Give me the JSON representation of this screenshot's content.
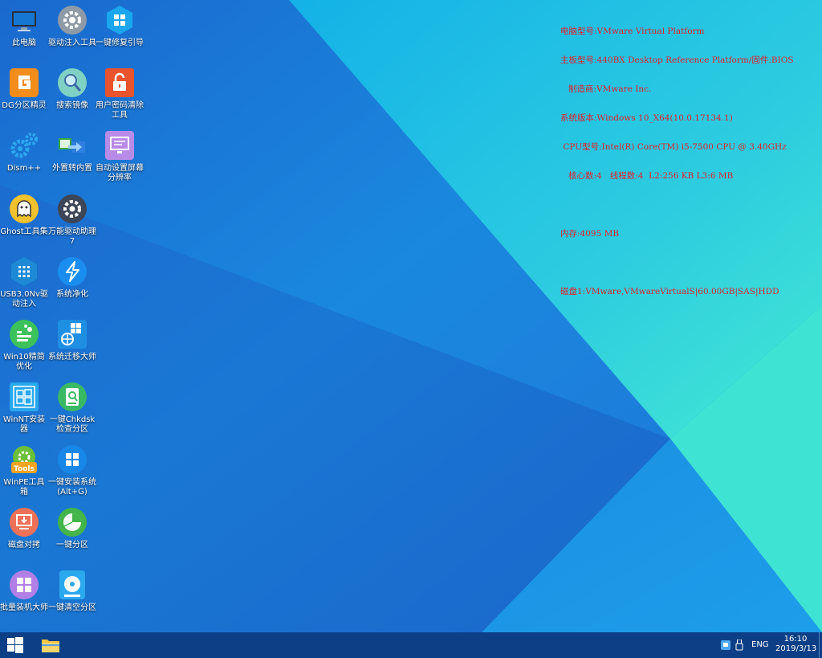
{
  "desktop_icons": [
    {
      "id": "this-pc",
      "label": "此电脑"
    },
    {
      "id": "driver-inject",
      "label": "驱动注入工具"
    },
    {
      "id": "boot-repair",
      "label": "一键修复引导"
    },
    {
      "id": "diskgenius",
      "label": "DG分区精灵"
    },
    {
      "id": "search-image",
      "label": "搜索镜像"
    },
    {
      "id": "password-clear",
      "label": "用户密码清除工具"
    },
    {
      "id": "dism",
      "label": "Dism++"
    },
    {
      "id": "external-internal",
      "label": "外置转内置"
    },
    {
      "id": "auto-resolution",
      "label": "自动设置屏幕分辨率"
    },
    {
      "id": "ghost",
      "label": "Ghost工具集"
    },
    {
      "id": "universal-driver",
      "label": "万能驱动助理7"
    },
    {
      "id": "usb3-driver",
      "label": "USB3.0Nv驱动注入"
    },
    {
      "id": "system-clean",
      "label": "系统净化"
    },
    {
      "id": "win10-optimize",
      "label": "Win10精简优化"
    },
    {
      "id": "system-migrate",
      "label": "系统迁移大师"
    },
    {
      "id": "winnt-setup",
      "label": "WinNT安装器"
    },
    {
      "id": "chkdsk",
      "label": "一键Chkdsk检查分区"
    },
    {
      "id": "winpe-tools",
      "label": "WinPE工具箱"
    },
    {
      "id": "install-system",
      "label": "一键安装系统(Alt+G)"
    },
    {
      "id": "disk-copy",
      "label": "磁盘对拷"
    },
    {
      "id": "one-key-partition",
      "label": "一键分区"
    },
    {
      "id": "batch-install",
      "label": "批量装机大师"
    },
    {
      "id": "clear-partition",
      "label": "一键清空分区"
    }
  ],
  "sysinfo": {
    "lines": [
      "电脑型号:VMware Virtual Platform",
      "主板型号:440BX Desktop Reference Platform/固件:BIOS",
      "   制造商:VMware Inc.",
      "系统版本:Windows 10_X64(10.0.17134.1)",
      " CPU型号:Intel(R) Core(TM) i5-7500 CPU @ 3.40GHz",
      "   核心数:4   线程数:4  L2:256 KB L3:6 MB"
    ],
    "memory": "内存:4095 MB",
    "disk": "磁盘1:VMware,VMwareVirtualS|60.00GB|SAS|HDD"
  },
  "taskbar": {
    "language": "ENG",
    "time": "16:10",
    "date": "2019/3/13"
  },
  "colors": {
    "wallpaper_blue": "#1f76d6",
    "wallpaper_cyan": "#3ee6d6",
    "taskbar": "#0c3f86",
    "sysinfo_text": "#e0202b"
  }
}
